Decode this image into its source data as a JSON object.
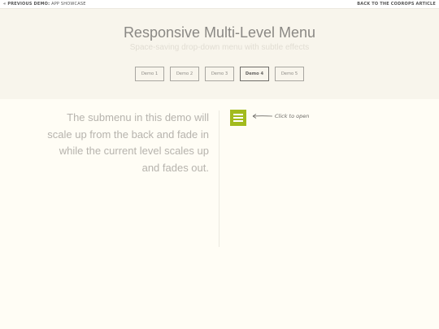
{
  "topbar": {
    "prev_label": "« Previous Demo:",
    "prev_name": "App Showcase",
    "back_label": "Back to the Codrops Article"
  },
  "header": {
    "title": "Responsive Multi-Level Menu",
    "subtitle": "Space-saving drop-down menu with subtle effects"
  },
  "demos": [
    {
      "label": "Demo 1",
      "active": false
    },
    {
      "label": "Demo 2",
      "active": false
    },
    {
      "label": "Demo 3",
      "active": false
    },
    {
      "label": "Demo 4",
      "active": true
    },
    {
      "label": "Demo 5",
      "active": false
    }
  ],
  "main": {
    "description": "The submenu in this demo will scale up from the back and fade in while the current level scales up and fades out.",
    "hint": "Click to open"
  },
  "colors": {
    "accent": "#a2bb1d",
    "header_bg": "#f8f5ec",
    "page_bg": "#fffdf5"
  },
  "icons": {
    "menu_trigger": "hamburger-menu-icon",
    "hint_arrow": "arrow-left-icon"
  }
}
